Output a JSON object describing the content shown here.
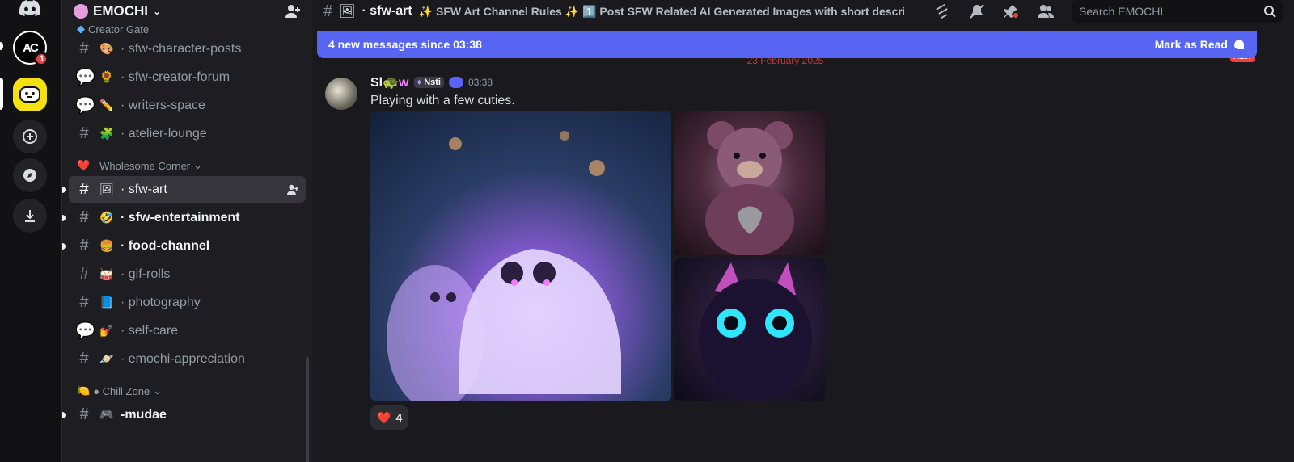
{
  "server": {
    "name": "EMOCHI"
  },
  "rail": {
    "ac_label": "AC",
    "ac_badge": "1"
  },
  "sidebar": {
    "categories": [
      {
        "name": "Creator Gate"
      },
      {
        "name": "Wholesome Corner",
        "emoji": "❤️"
      },
      {
        "name": "Chill Zone",
        "emoji": "🍋"
      }
    ],
    "channels": [
      {
        "emoji": "🎨",
        "label": "sfw-character-posts",
        "type": "text"
      },
      {
        "emoji": "🌻",
        "label": "sfw-creator-forum",
        "type": "forum"
      },
      {
        "emoji": "✏️",
        "label": "writers-space",
        "type": "forum"
      },
      {
        "emoji": "🧩",
        "label": "atelier-lounge",
        "type": "text"
      },
      {
        "emoji": "🖼",
        "label": "sfw-art",
        "type": "text",
        "active": true
      },
      {
        "emoji": "🤣",
        "label": "sfw-entertainment",
        "type": "text",
        "unread": true
      },
      {
        "emoji": "🍔",
        "label": "food-channel",
        "type": "text",
        "unread": true
      },
      {
        "emoji": "🥁",
        "label": "gif-rolls",
        "type": "text"
      },
      {
        "emoji": "📘",
        "label": "photography",
        "type": "text"
      },
      {
        "emoji": "💅",
        "label": "self-care",
        "type": "forum"
      },
      {
        "emoji": "🪐",
        "label": "emochi-appreciation",
        "type": "text"
      },
      {
        "emoji": "🎮",
        "label": "-mudae",
        "type": "text",
        "unread": true
      }
    ]
  },
  "header": {
    "channel": "sfw-art",
    "channel_emoji": "🖼",
    "topic": "✨ SFW Art Channel Rules ✨ 1️⃣ Post SFW Related AI Generated Images with short descri...",
    "search_placeholder": "Search EMOCHI"
  },
  "banner": {
    "text": "4 new messages since 03:38",
    "mark_read": "Mark as Read",
    "date": "23 February 2025",
    "new_label": "NEW"
  },
  "message": {
    "username_a": "Sl",
    "username_b": "w",
    "tag": "Nsti",
    "time": "03:38",
    "text": "Playing with a few cuties.",
    "reaction_emoji": "❤️",
    "reaction_count": "4"
  }
}
